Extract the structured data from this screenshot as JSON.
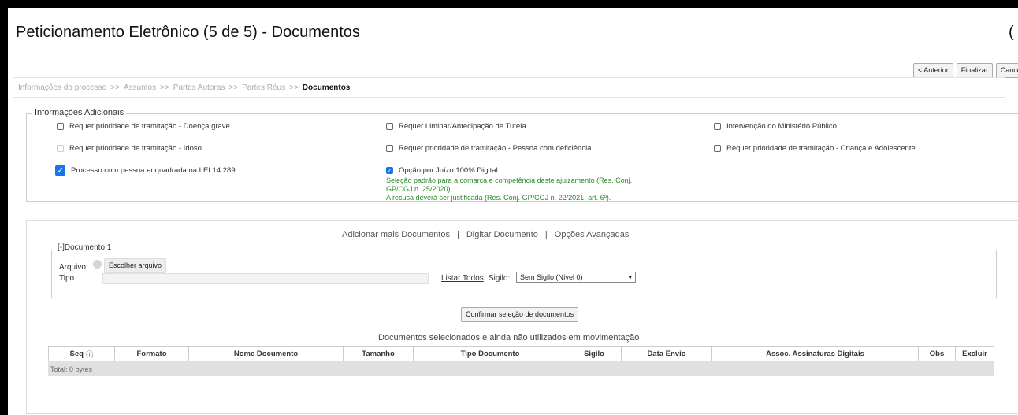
{
  "header": {
    "title": "Peticionamento Eletrônico (5 de 5) - Documentos",
    "partial_icon": "clock-icon",
    "buttons": {
      "anterior": "< Anterior",
      "finalizar": "Finalizar",
      "cancelar": "Cancelar"
    }
  },
  "breadcrumb": {
    "items": [
      "Informações do processo",
      "Assuntos",
      "Partes Autoras",
      "Partes Réus",
      "Documentos"
    ],
    "separator": ">>"
  },
  "info": {
    "legend": "Informações Adicionais",
    "options": [
      {
        "label": "Requer prioridade de tramitação - Doença grave",
        "checked": false,
        "disabled": false
      },
      {
        "label": "Requer Liminar/Antecipação de Tutela",
        "checked": false,
        "disabled": false
      },
      {
        "label": "Intervenção do Ministério Público",
        "checked": false,
        "disabled": false
      },
      {
        "label": "Requer prioridade de tramitação - Idoso",
        "checked": false,
        "disabled": true
      },
      {
        "label": "Requer prioridade de tramitação - Pessoa com deficiência",
        "checked": false,
        "disabled": false
      },
      {
        "label": "Requer prioridade de tramitação - Criança e Adolescente",
        "checked": false,
        "disabled": false
      },
      {
        "label": "Processo com pessoa enquadrada na LEI 14.289",
        "checked": true,
        "disabled": false
      },
      {
        "label": "Opção por Juízo 100% Digital",
        "checked": true,
        "disabled": false
      }
    ],
    "note_lines": [
      "Seleção padrão para a comarca e competência deste ajuizamento (Res. Conj.",
      "GP/CGJ n. 25/2020).",
      "A recusa deverá ser justificada (Res. Conj. GP/CGJ n. 22/2021, art. 6º)."
    ]
  },
  "documents": {
    "links": [
      "Adicionar mais Documentos",
      "Digitar Documento",
      "Opções Avançadas"
    ],
    "doc_legend": "[-]Documento 1",
    "arquivo_label": "Arquivo:",
    "choose_file": "Escolher arquivo",
    "tipo_label": "Tipo",
    "listar_todos": "Listar Todos",
    "sigilo_label": "Sigilo:",
    "sigilo_value": "Sem Sigilo (Nível 0)",
    "confirm_button": "Confirmar seleção de documentos",
    "table_title": "Documentos selecionados e ainda não utilizados em movimentação",
    "columns": [
      "Seq",
      "Formato",
      "Nome Documento",
      "Tamanho",
      "Tipo Documento",
      "Sigilo",
      "Data Envio",
      "Assoc. Assinaturas Digitais",
      "Obs",
      "Excluir"
    ],
    "total": "Total: 0 bytes"
  },
  "colors": {
    "accent": "#1a73e8",
    "note": "#2a8a2a"
  }
}
